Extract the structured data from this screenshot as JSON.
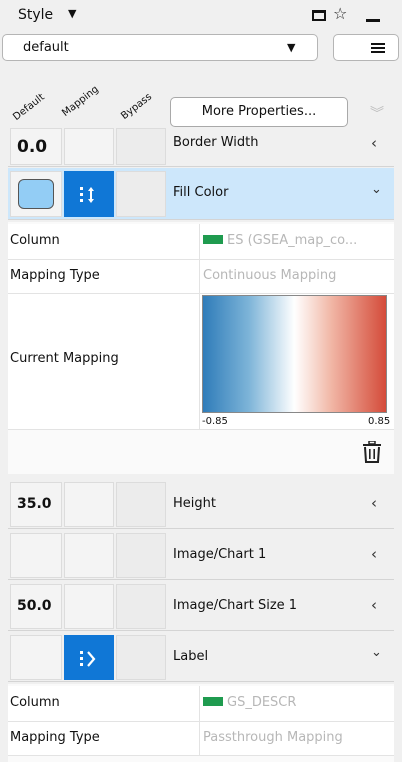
{
  "header": {
    "title": "Style"
  },
  "style_selector": {
    "value": "default"
  },
  "columns": {
    "default": "Default",
    "mapping": "Mapping",
    "bypass": "Bypass"
  },
  "more_properties": "More Properties...",
  "properties": [
    {
      "name": "Border Width",
      "default_value": "0.0",
      "state": "collapsed"
    },
    {
      "name": "Fill Color",
      "default_color": "#93cdf5",
      "mapping": "continuous",
      "state": "expanded"
    },
    {
      "name": "Height",
      "default_value": "35.0",
      "state": "collapsed"
    },
    {
      "name": "Image/Chart 1",
      "default_value": "",
      "state": "collapsed"
    },
    {
      "name": "Image/Chart Size 1",
      "default_value": "50.0",
      "state": "collapsed"
    },
    {
      "name": "Label",
      "mapping": "passthrough",
      "state": "expanded"
    }
  ],
  "fill_color_mapping": {
    "column_label": "Column",
    "column_value": "ES (GSEA_map_co...",
    "type_label": "Mapping Type",
    "type_value": "Continuous Mapping",
    "current_label": "Current Mapping",
    "range_min": "-0.85",
    "range_max": "0.85",
    "gradient_colors": [
      "#2f7cb9",
      "#ffffff",
      "#d44b3a"
    ]
  },
  "label_mapping": {
    "column_label": "Column",
    "column_value": "GS_DESCR",
    "type_label": "Mapping Type",
    "type_value": "Passthrough Mapping"
  },
  "colors": {
    "accent": "#1077d6",
    "selected_row": "#cde7fb"
  }
}
